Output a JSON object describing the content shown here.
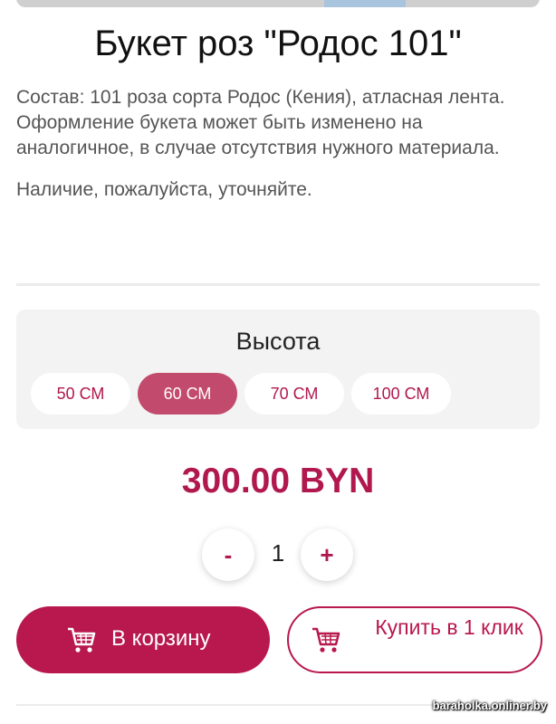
{
  "product": {
    "title": "Букет роз \"Родос 101\"",
    "description_lines": [
      "Состав: 101 роза сорта Родос (Кения), атласная лента.",
      "Оформление букета может быть изменено на аналогичное, в случае отсутствия нужного материала.",
      "Наличие, пожалуйста, уточняйте."
    ]
  },
  "height": {
    "title": "Высота",
    "options": [
      "50 СМ",
      "60 СМ",
      "70 СМ",
      "100 СМ"
    ],
    "selected": "60 СМ"
  },
  "price": "300.00 BYN",
  "quantity": {
    "minus_label": "-",
    "value": "1",
    "plus_label": "+"
  },
  "buttons": {
    "cart_label": "В корзину",
    "buy_one_click_label": "Купить в 1 клик",
    "cart_icon": "shopping-cart-icon"
  },
  "colors": {
    "accent": "#b8184d",
    "selected_option": "#c24a6c",
    "panel_bg": "#f3f3f3"
  },
  "watermark": "baraholka.onliner.by"
}
